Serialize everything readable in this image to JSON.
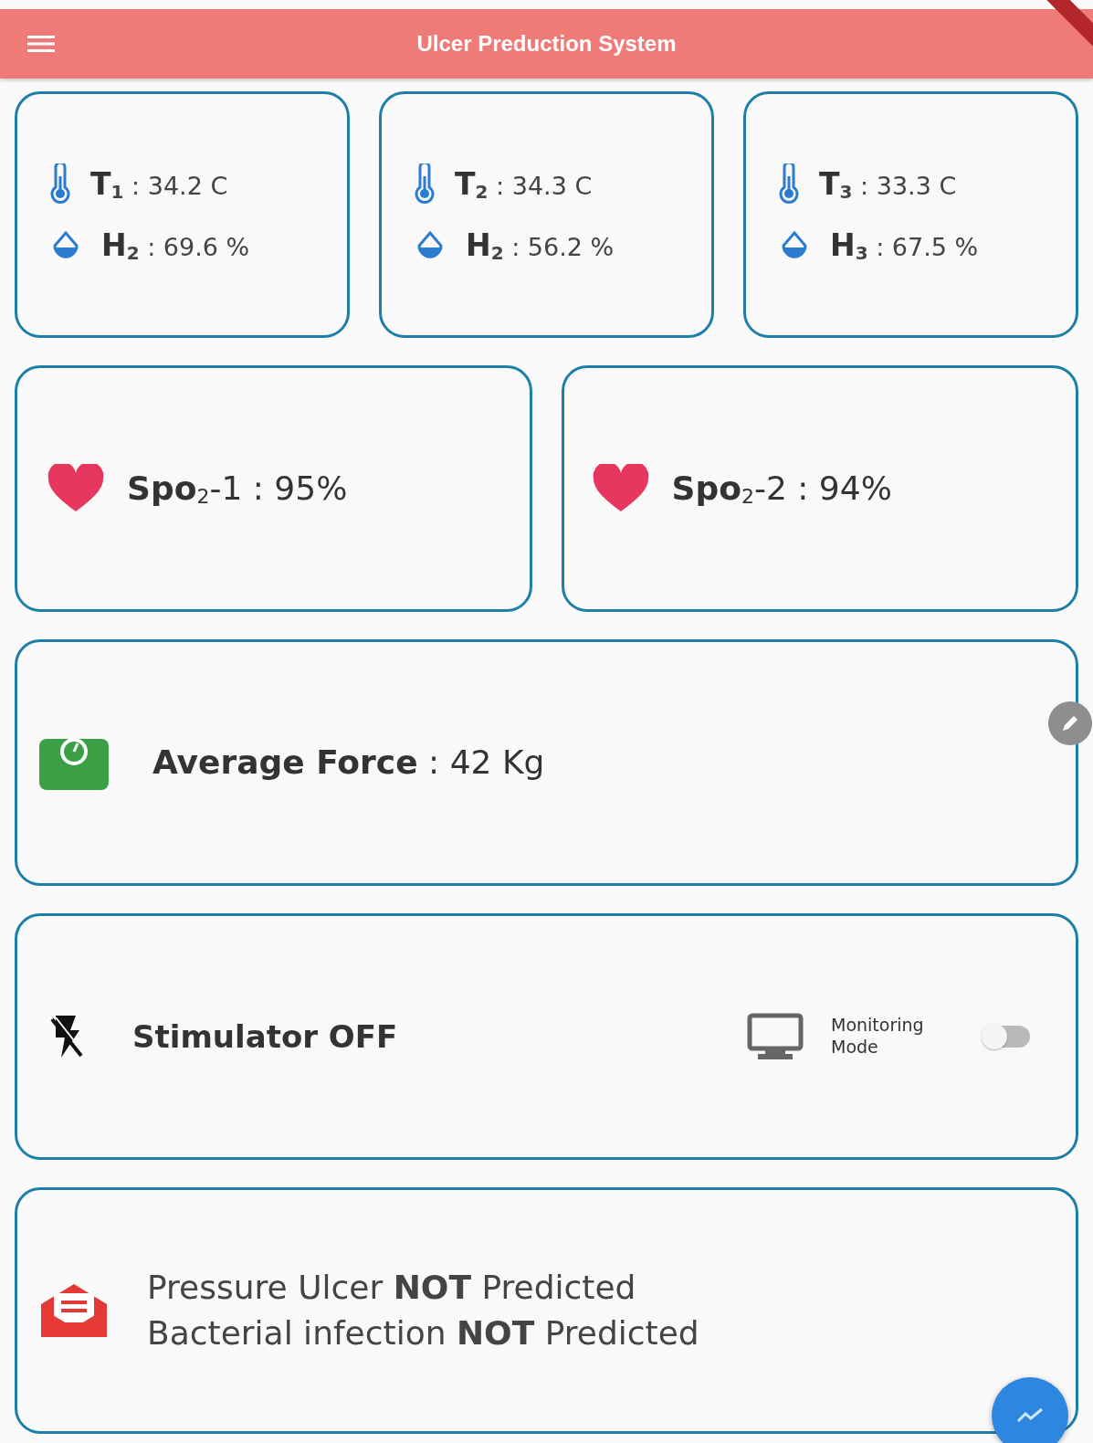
{
  "app_bar": {
    "title": "Ulcer Preduction System"
  },
  "sensor_cards": [
    {
      "temperature": "**T**$_{1}$ : 34.2 C",
      "humidity": "**H**$_{2}$ : 69.6 %"
    },
    {
      "temperature": "**T**$_{2}$ : 34.3 C",
      "humidity": "**H**$_{2}$ : 56.2 %"
    },
    {
      "temperature": "**T**$_{3}$ : 33.3 C",
      "humidity": "**H**$_{3}$ : 67.5 %"
    }
  ],
  "spo2_cards": [
    {
      "reading": "**Spo**$_{2}$-1 : 95%"
    },
    {
      "reading": "**Spo**$_{2}$-2 : 94%"
    }
  ],
  "force_card": {
    "reading": "**Average Force** : 42 Kg"
  },
  "stimulator_card": {
    "status": "Stimulator OFF",
    "monitoring_label": "Monitoring Mode",
    "monitoring_on": false
  },
  "prediction_card": {
    "lines": [
      "Pressure Ulcer **NOT** Predicted",
      "Bacterial infection **NOT** Predicted"
    ]
  }
}
